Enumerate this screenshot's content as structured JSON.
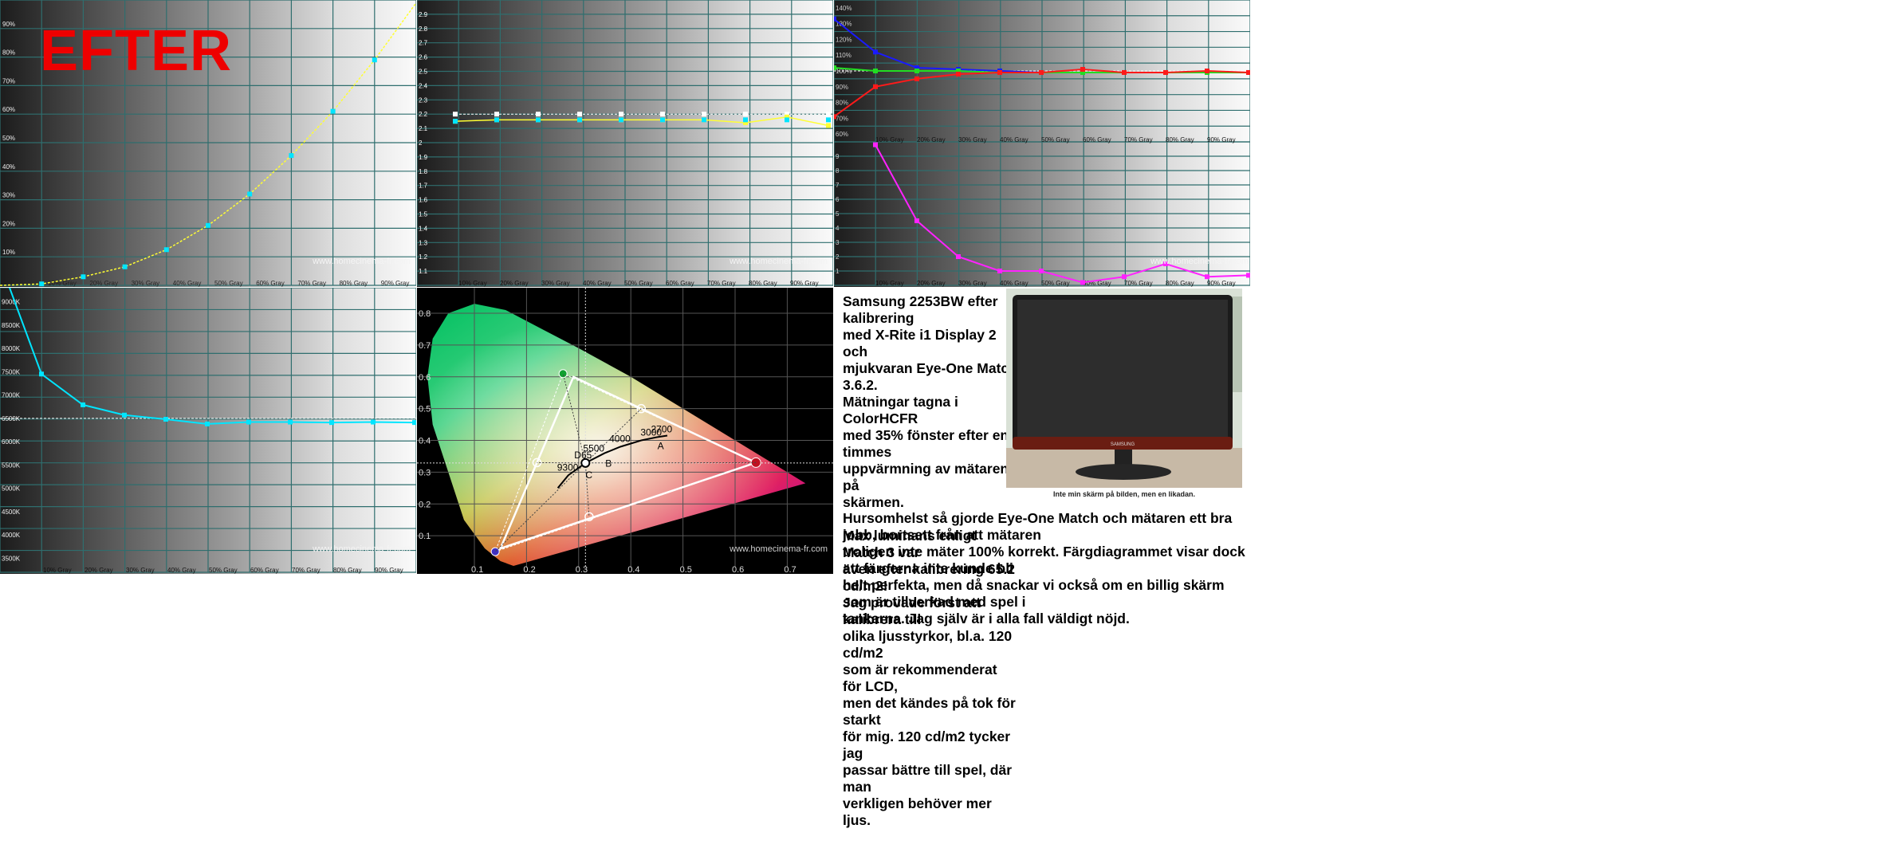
{
  "overlay_title": "EFTER",
  "watermark": "www.homecinema-fr.com",
  "colors": {
    "yellow": "#ffff33",
    "cyan": "#00e5ff",
    "red": "#ff1a1a",
    "green": "#22dd22",
    "blue": "#1a1aff",
    "magenta": "#ff22ff",
    "white": "#ffffff",
    "efter": "#ee0000"
  },
  "chart_data": [
    {
      "type": "line",
      "name": "luminance",
      "x": [
        "",
        "10% Gray",
        "20% Gray",
        "30% Gray",
        "40% Gray",
        "50% Gray",
        "60% Gray",
        "70% Gray",
        "80% Gray",
        "90% Gray"
      ],
      "y_ticks": [
        "10%",
        "20%",
        "30%",
        "40%",
        "50%",
        "60%",
        "70%",
        "80%",
        "90%"
      ],
      "series": [
        {
          "values": [
            0,
            0.5,
            3,
            6.5,
            12.5,
            21,
            32,
            45.5,
            61,
            79,
            99
          ]
        }
      ],
      "ylim": [
        0,
        100
      ]
    },
    {
      "type": "line",
      "name": "gamma",
      "x": [
        "10% Gray",
        "20% Gray",
        "30% Gray",
        "40% Gray",
        "50% Gray",
        "60% Gray",
        "70% Gray",
        "80% Gray",
        "90% Gray"
      ],
      "y_ticks": [
        "1.1",
        "1.2",
        "1.3",
        "1.4",
        "1.5",
        "1.6",
        "1.7",
        "1.8",
        "1.9",
        "2",
        "2.1",
        "2.2",
        "2.3",
        "2.4",
        "2.5",
        "2.6",
        "2.7",
        "2.8",
        "2.9"
      ],
      "target": [
        2.2,
        2.2,
        2.2,
        2.2,
        2.2,
        2.2,
        2.2,
        2.2,
        2.2,
        2.2
      ],
      "series": [
        {
          "values": [
            2.15,
            2.16,
            2.16,
            2.16,
            2.16,
            2.16,
            2.16,
            2.14,
            2.18,
            2.12
          ]
        },
        {
          "values": [
            2.15,
            2.16,
            2.16,
            2.16,
            2.16,
            2.16,
            2.16,
            2.16,
            2.16,
            2.16
          ]
        }
      ],
      "ylim": [
        1.0,
        3.0
      ]
    },
    {
      "type": "line",
      "name": "rgb-balance",
      "x": [
        "10% Gray",
        "20% Gray",
        "30% Gray",
        "40% Gray",
        "50% Gray",
        "60% Gray",
        "70% Gray",
        "80% Gray",
        "90% Gray"
      ],
      "y_ticks": [
        "60%",
        "70%",
        "80%",
        "90%",
        "100%",
        "110%",
        "120%",
        "130%",
        "140%"
      ],
      "series": [
        {
          "values": [
            133,
            112,
            102,
            101,
            100,
            99,
            99,
            99,
            99,
            99,
            99
          ]
        },
        {
          "values": [
            102,
            100,
            100,
            100,
            99,
            99,
            99,
            99,
            99,
            99,
            99
          ]
        },
        {
          "values": [
            71,
            90,
            95,
            98,
            99,
            99,
            101,
            99,
            99,
            100,
            99
          ]
        }
      ],
      "ylim": [
        55,
        145
      ]
    },
    {
      "type": "line",
      "name": "delta-e",
      "x": [
        "10% Gray",
        "20% Gray",
        "30% Gray",
        "40% Gray",
        "50% Gray",
        "60% Gray",
        "70% Gray",
        "80% Gray",
        "90% Gray"
      ],
      "y_ticks": [
        "1",
        "2",
        "3",
        "4",
        "5",
        "6",
        "7",
        "8",
        "9"
      ],
      "series": [
        {
          "values": [
            9.8,
            4.5,
            2.0,
            1.0,
            1.0,
            0.2,
            0.6,
            1.5,
            0.6,
            0.7
          ]
        }
      ],
      "ylim": [
        0,
        10
      ]
    },
    {
      "type": "line",
      "name": "color-temperature",
      "x": [
        "",
        "10% Gray",
        "20% Gray",
        "30% Gray",
        "40% Gray",
        "50% Gray",
        "60% Gray",
        "70% Gray",
        "80% Gray",
        "90% Gray"
      ],
      "y_ticks": [
        "3500K",
        "4000K",
        "4500K",
        "5000K",
        "5500K",
        "6000K",
        "6500K",
        "7000K",
        "7500K",
        "8000K",
        "8500K",
        "9000K"
      ],
      "reference": 6500,
      "series": [
        {
          "values": [
            9300,
            7450,
            6790,
            6570,
            6480,
            6380,
            6420,
            6420,
            6410,
            6420,
            6410
          ]
        }
      ],
      "ylim": [
        3200,
        9300
      ]
    },
    {
      "type": "scatter",
      "name": "cie-xy",
      "x_ticks": [
        "0.1",
        "0.2",
        "0.3",
        "0.4",
        "0.5",
        "0.6",
        "0.7"
      ],
      "y_ticks": [
        "0.1",
        "0.2",
        "0.3",
        "0.4",
        "0.5",
        "0.6",
        "0.7",
        "0.8"
      ],
      "xlim": [
        0.0,
        0.8
      ],
      "ylim": [
        0.0,
        0.9
      ],
      "measured": {
        "red": [
          0.64,
          0.33
        ],
        "green": [
          0.27,
          0.61
        ],
        "blue": [
          0.14,
          0.05
        ]
      },
      "target": {
        "red": [
          0.64,
          0.33
        ],
        "green": [
          0.29,
          0.6
        ],
        "blue": [
          0.15,
          0.06
        ]
      },
      "secondaries": [
        [
          0.42,
          0.5
        ],
        [
          0.22,
          0.33
        ],
        [
          0.32,
          0.16
        ]
      ],
      "white": [
        0.313,
        0.329
      ],
      "planck_labels": [
        {
          "t": "2700",
          "x": 0.46,
          "y": 0.41
        },
        {
          "t": "3000",
          "x": 0.44,
          "y": 0.4
        },
        {
          "t": "4000",
          "x": 0.38,
          "y": 0.38
        },
        {
          "t": "5500",
          "x": 0.33,
          "y": 0.35
        },
        {
          "t": "D65",
          "x": 0.313,
          "y": 0.329
        },
        {
          "t": "9300",
          "x": 0.28,
          "y": 0.29
        }
      ],
      "letters": [
        {
          "t": "A",
          "x": 0.448,
          "y": 0.408
        },
        {
          "t": "B",
          "x": 0.348,
          "y": 0.352
        },
        {
          "t": "C",
          "x": 0.31,
          "y": 0.316
        }
      ]
    }
  ],
  "text": {
    "p1": "Samsung 2253BW efter kalibrering\nmed X-Rite i1 Display 2 och\nmjukvaran Eye-One Match 3.6.2.\nMätningar tagna i ColorHCFR\nmed 35% fönster efter en timmes\nuppvärmning av mätaren på\nskärmen.",
    "p2": "Max luminans enligt Match 3 var\näven efter kalibrering 65.2 cd/m2!\nJag provade först att kalibrera till\nolika ljusstyrkor, bl.a. 120 cd/m2\nsom är rekommenderat för LCD,\nmen det kändes på tok för starkt\nför mig. 120 cd/m2 tycker jag\npassar bättre till spel, där man\nverkligen behöver mer ljus.",
    "p3": "Hursomhelst så gjorde Eye-One Match och mätaren ett bra jobb, bortsett från att mätaren\ntroligen inte mäter 100% korrekt. Färgdiagrammet visar dock att färgerna inte kunde bli\nhelt perfekta, men då snackar vi också om en billig skärm som är tillverkad med spel i\ntankarna. Jag själv är i alla fall väldigt nöjd.",
    "photo_caption": "Inte min skärm på bilden, men en likadan.",
    "monitor_brand": "SAMSUNG"
  }
}
